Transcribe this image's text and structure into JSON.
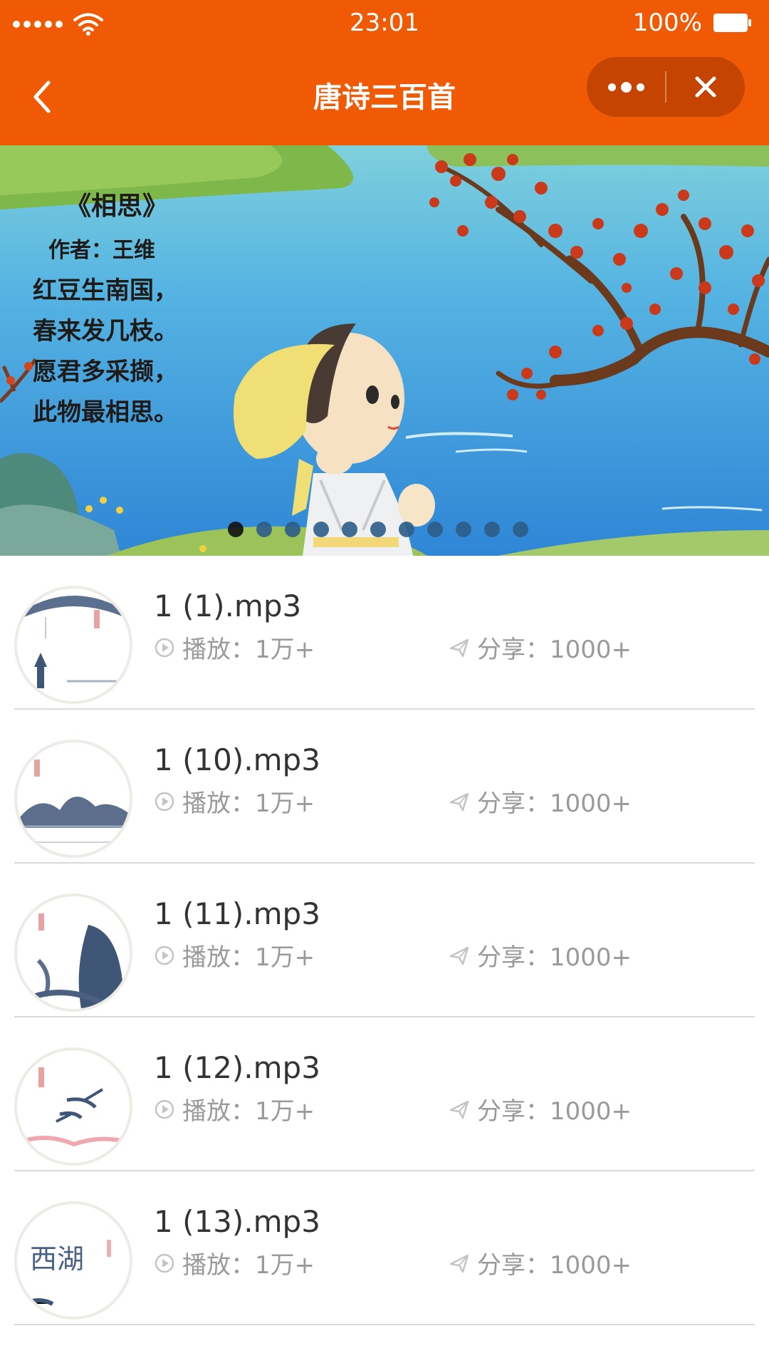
{
  "status_bar": {
    "time": "23:01",
    "battery": "100%"
  },
  "nav": {
    "title": "唐诗三百首"
  },
  "banner": {
    "poem_title": "《相思》",
    "poem_author": "作者：王维",
    "poem_lines": [
      "红豆生南国，",
      "春来发几枝。",
      "愿君多采撷，",
      "此物最相思。"
    ],
    "slide_count": 11,
    "active_slide": 1
  },
  "list": {
    "play_label": "播放：",
    "share_label": "分享：",
    "items": [
      {
        "name": "1 (1).mp3",
        "plays": "1万+",
        "shares": "1000+"
      },
      {
        "name": "1 (10).mp3",
        "plays": "1万+",
        "shares": "1000+"
      },
      {
        "name": "1 (11).mp3",
        "plays": "1万+",
        "shares": "1000+"
      },
      {
        "name": "1 (12).mp3",
        "plays": "1万+",
        "shares": "1000+"
      },
      {
        "name": "1 (13).mp3",
        "plays": "1万+",
        "shares": "1000+"
      }
    ]
  },
  "colors": {
    "accent": "#f15a05",
    "capsule": "#c64402",
    "meta_text": "#9a9a9a"
  }
}
